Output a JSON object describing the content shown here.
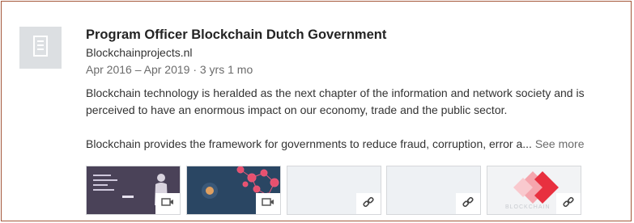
{
  "experience": {
    "title": "Program Officer Blockchain Dutch Government",
    "company": "Blockchainprojects.nl",
    "dates": "Apr 2016 – Apr 2019 · 3 yrs 1 mo",
    "description_p1": "Blockchain technology is heralded as the next chapter of the information and network society and is perceived to have an enormous impact on our economy, trade and the public sector.",
    "description_p2": "Blockchain provides the framework for governments to reduce fraud, corruption, error a...",
    "see_more": "See more",
    "logo_icon": "building-icon",
    "media": [
      {
        "kind": "video",
        "icon": "video-icon"
      },
      {
        "kind": "video",
        "icon": "video-icon"
      },
      {
        "kind": "link",
        "icon": "link-icon"
      },
      {
        "kind": "link",
        "icon": "link-icon"
      },
      {
        "kind": "link",
        "icon": "link-icon",
        "watermark": "BLOCKCHAIN"
      }
    ]
  },
  "colors": {
    "frame_border": "#a4573a",
    "title": "#242424",
    "muted": "#6b6b6b",
    "accent_red": "#e8303f"
  }
}
